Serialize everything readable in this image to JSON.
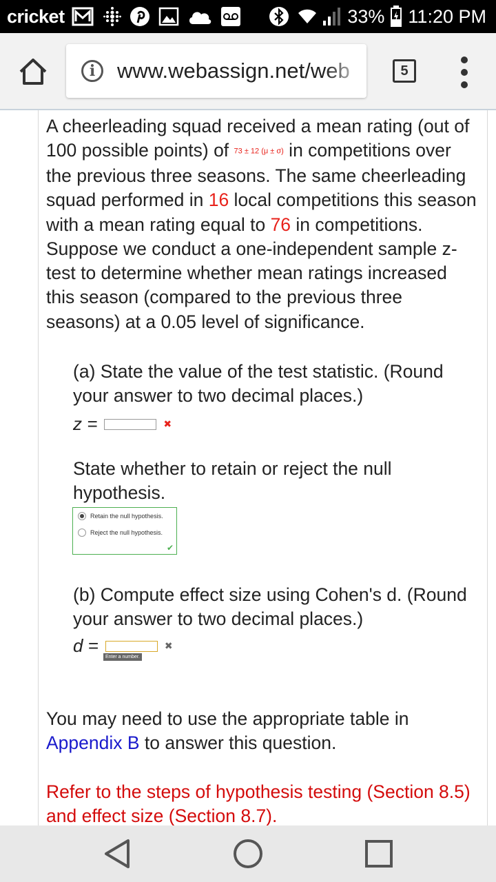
{
  "status_bar": {
    "carrier": "cricket",
    "battery": "33%",
    "time": "11:20 PM"
  },
  "browser": {
    "url": "www.webassign.net/web",
    "tab_count": "5"
  },
  "question": {
    "p1": "A cheerleading squad received a mean rating (out of 100 possible points) of ",
    "mean_sd": "73 ± 12 (μ ± σ)",
    "p2": " in competitions over the previous three seasons. The same cheerleading squad performed in ",
    "n": "16",
    "p3": " local competitions this season with a mean rating equal to ",
    "sample_mean": "76",
    "p4": " in competitions. Suppose we conduct a one-independent sample z-test to determine whether mean ratings increased this season (compared to the previous three seasons) at a 0.05 level of significance."
  },
  "part_a": {
    "prompt": "(a) State the value of the test statistic. (Round your answer to two decimal places.)",
    "z_label": "z =",
    "z_value": "",
    "null_prompt": "State whether to retain or reject the null hypothesis.",
    "options": [
      "Retain the null hypothesis.",
      "Reject the null hypothesis."
    ],
    "selected_option": 0
  },
  "part_b": {
    "prompt": "(b) Compute effect size using Cohen's d. (Round your answer to two decimal places.)",
    "d_label": "d =",
    "d_value": "",
    "tooltip": "Enter a number."
  },
  "notes": {
    "table_p1": "You may need to use the appropriate table in ",
    "table_link": "Appendix B",
    "table_p2": " to answer this question.",
    "refer": "Refer to the steps of hypothesis testing (Section 8.5) and effect size (Section 8.7)."
  },
  "colors": {
    "accent_red": "#e8221b",
    "link_blue": "#1a1acc",
    "correct_green": "#4caf50"
  }
}
